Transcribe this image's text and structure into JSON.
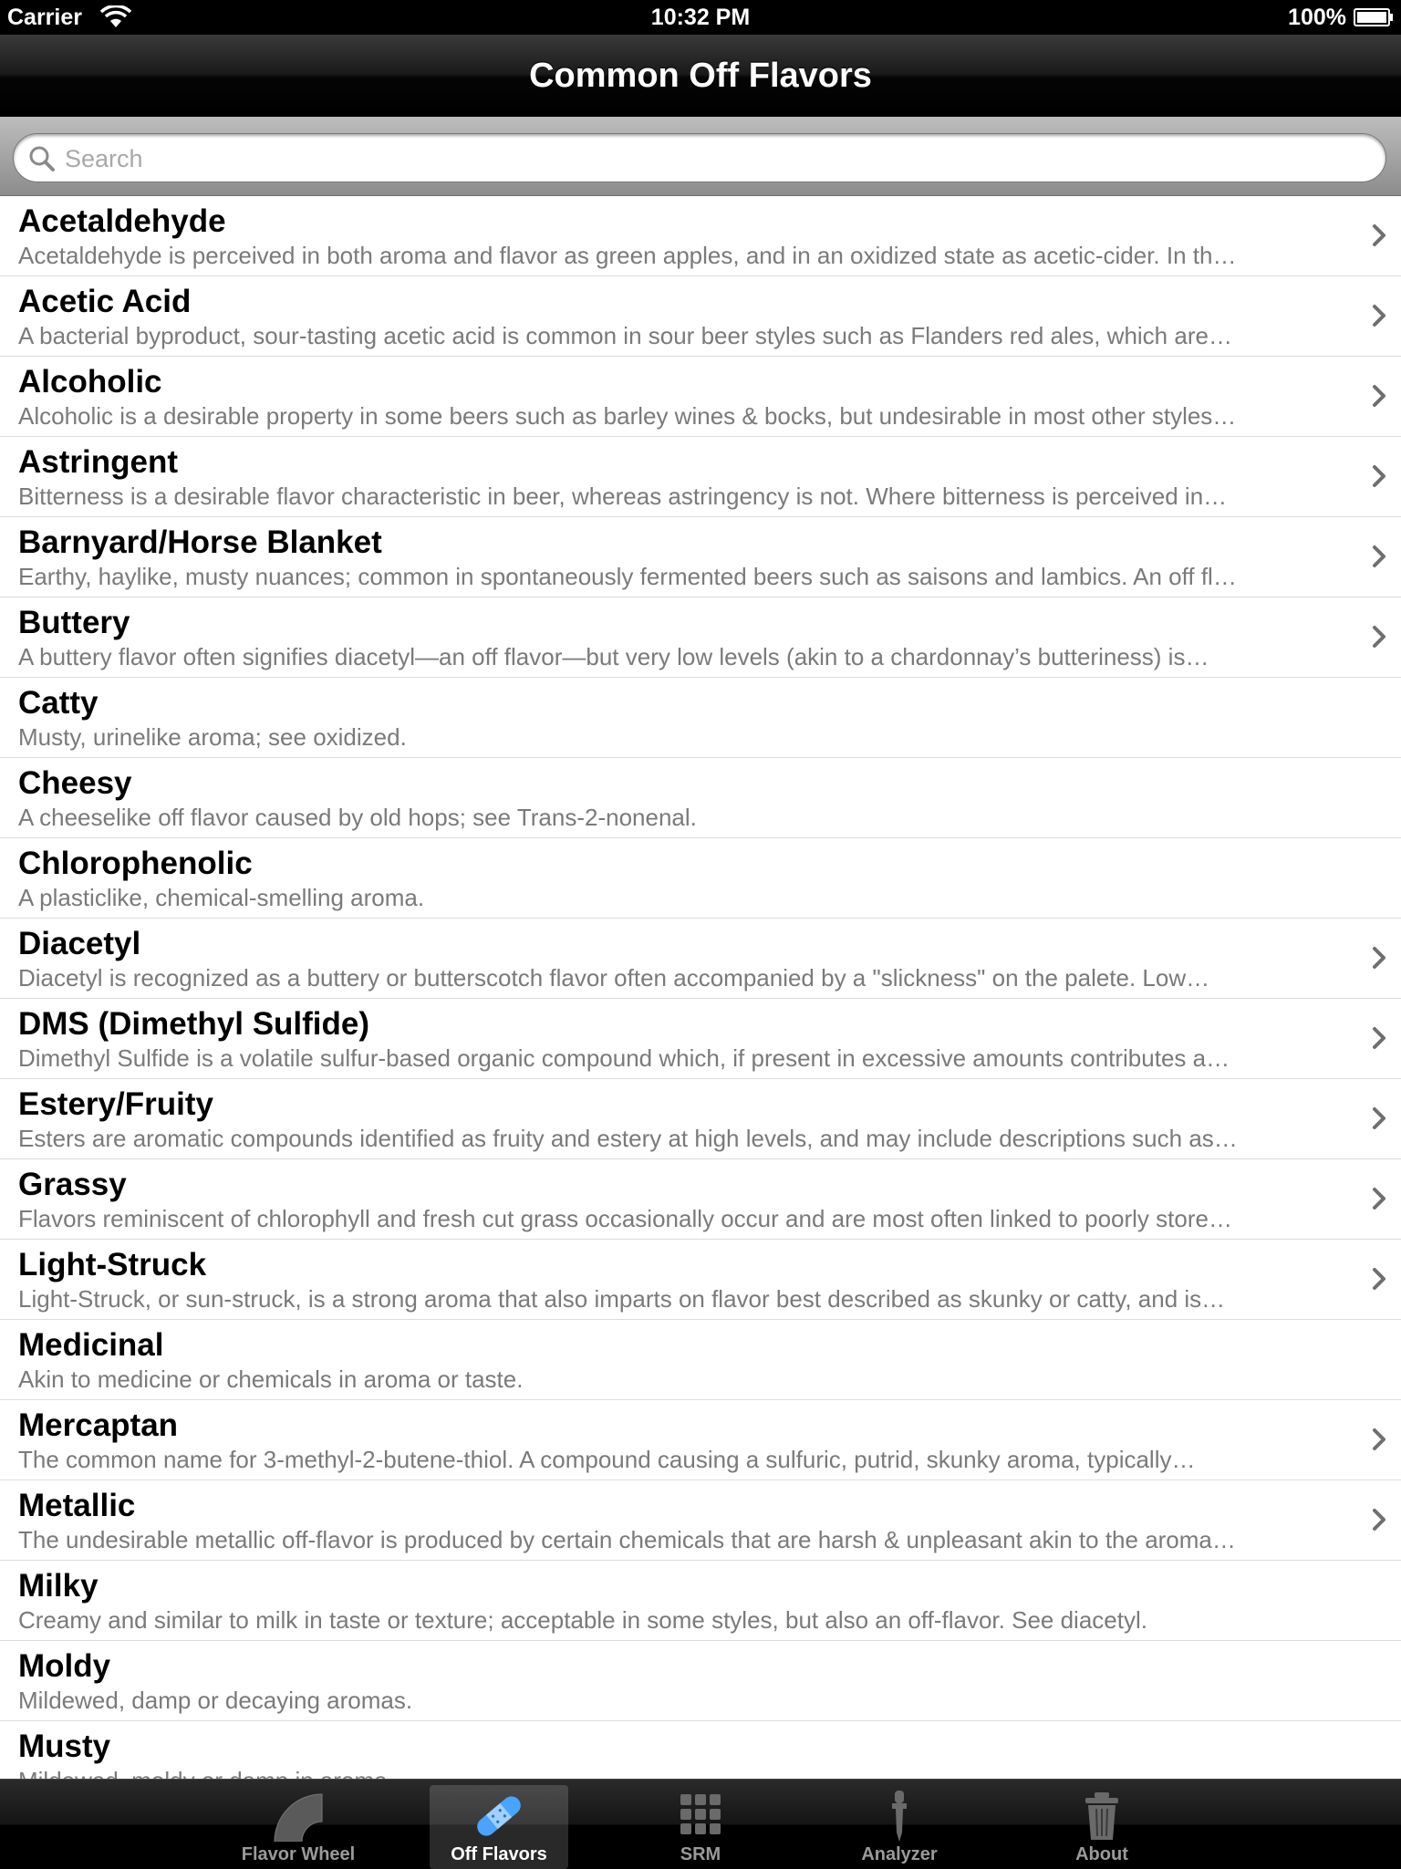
{
  "status_bar": {
    "carrier": "Carrier",
    "time": "10:32 PM",
    "battery": "100%"
  },
  "nav": {
    "title": "Common Off Flavors"
  },
  "search": {
    "placeholder": "Search",
    "value": ""
  },
  "items": [
    {
      "name": "Acetaldehyde",
      "desc": "Acetaldehyde is perceived in both aroma and flavor as green apples, and in an oxidized state as acetic-cider. In th…",
      "chevron": true
    },
    {
      "name": "Acetic Acid",
      "desc": "A bacterial byproduct, sour-tasting acetic acid is common in sour beer styles such as Flanders red ales, which are…",
      "chevron": true
    },
    {
      "name": "Alcoholic",
      "desc": "Alcoholic is a desirable property in some beers such as barley wines & bocks, but undesirable in most other styles…",
      "chevron": true
    },
    {
      "name": "Astringent",
      "desc": "Bitterness is a desirable flavor characteristic in beer, whereas astringency is not. Where bitterness is perceived in…",
      "chevron": true
    },
    {
      "name": "Barnyard/Horse Blanket",
      "desc": "Earthy, haylike, musty nuances; common in spontaneously fermented beers such as saisons and lambics. An off fl…",
      "chevron": true
    },
    {
      "name": "Buttery",
      "desc": "A buttery flavor often signifies diacetyl—an off flavor—but very low levels (akin to a chardonnay’s butteriness) is…",
      "chevron": true
    },
    {
      "name": "Catty",
      "desc": "Musty, urinelike aroma; see oxidized.",
      "chevron": false
    },
    {
      "name": "Cheesy",
      "desc": "A cheeselike off flavor caused by old hops; see Trans-2-nonenal.",
      "chevron": false
    },
    {
      "name": "Chlorophenolic",
      "desc": "A plasticlike, chemical-smelling aroma.",
      "chevron": false
    },
    {
      "name": "Diacetyl",
      "desc": "Diacetyl is recognized as a buttery or butterscotch flavor often accompanied by a \"slickness\" on the palete. Low…",
      "chevron": true
    },
    {
      "name": "DMS (Dimethyl Sulfide)",
      "desc": "Dimethyl Sulfide is a volatile sulfur-based organic compound which, if present in excessive amounts contributes a…",
      "chevron": true
    },
    {
      "name": "Estery/Fruity",
      "desc": "Esters are aromatic compounds identified as fruity and estery at high levels, and may include descriptions such as…",
      "chevron": true
    },
    {
      "name": "Grassy",
      "desc": "Flavors reminiscent of chlorophyll and fresh cut grass occasionally occur and are most often linked to poorly store…",
      "chevron": true
    },
    {
      "name": "Light-Struck",
      "desc": "Light-Struck, or sun-struck, is a strong aroma that also imparts on flavor best described as skunky or catty, and is…",
      "chevron": true
    },
    {
      "name": "Medicinal",
      "desc": "Akin to medicine or chemicals in aroma or taste.",
      "chevron": false
    },
    {
      "name": "Mercaptan",
      "desc": "The common name for 3-methyl-2-butene-thiol. A compound causing a sulfuric, putrid, skunky aroma, typically…",
      "chevron": true
    },
    {
      "name": "Metallic",
      "desc": "The undesirable metallic off-flavor is produced by certain chemicals that are harsh & unpleasant akin to the aroma…",
      "chevron": true
    },
    {
      "name": "Milky",
      "desc": "Creamy and similar to milk in taste or texture; acceptable in some styles, but also an off-flavor. See diacetyl.",
      "chevron": false
    },
    {
      "name": "Moldy",
      "desc": "Mildewed, damp or decaying aromas.",
      "chevron": false
    },
    {
      "name": "Musty",
      "desc": "Mildewed, moldy or damp in aroma.",
      "chevron": false
    }
  ],
  "tabs": [
    {
      "label": "Flavor Wheel",
      "icon": "flavor-wheel-icon",
      "selected": false
    },
    {
      "label": "Off Flavors",
      "icon": "bandage-icon",
      "selected": true
    },
    {
      "label": "SRM",
      "icon": "grid-icon",
      "selected": false
    },
    {
      "label": "Analyzer",
      "icon": "dropper-icon",
      "selected": false
    },
    {
      "label": "About",
      "icon": "trash-can-icon",
      "selected": false
    }
  ],
  "colors": {
    "nav_bg": "#000000",
    "tab_selected_label": "#ffffff",
    "tab_label": "#9a9a9a",
    "row_desc": "#7a7a7a",
    "separator": "#dcdcdc"
  }
}
